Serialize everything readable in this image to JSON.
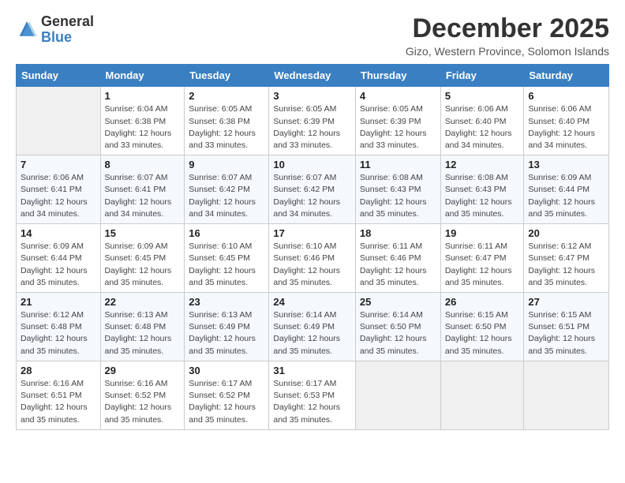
{
  "logo": {
    "general": "General",
    "blue": "Blue"
  },
  "title": "December 2025",
  "location": "Gizo, Western Province, Solomon Islands",
  "days_header": [
    "Sunday",
    "Monday",
    "Tuesday",
    "Wednesday",
    "Thursday",
    "Friday",
    "Saturday"
  ],
  "weeks": [
    [
      {
        "num": "",
        "empty": true
      },
      {
        "num": "1",
        "sunrise": "Sunrise: 6:04 AM",
        "sunset": "Sunset: 6:38 PM",
        "daylight": "Daylight: 12 hours and 33 minutes."
      },
      {
        "num": "2",
        "sunrise": "Sunrise: 6:05 AM",
        "sunset": "Sunset: 6:38 PM",
        "daylight": "Daylight: 12 hours and 33 minutes."
      },
      {
        "num": "3",
        "sunrise": "Sunrise: 6:05 AM",
        "sunset": "Sunset: 6:39 PM",
        "daylight": "Daylight: 12 hours and 33 minutes."
      },
      {
        "num": "4",
        "sunrise": "Sunrise: 6:05 AM",
        "sunset": "Sunset: 6:39 PM",
        "daylight": "Daylight: 12 hours and 33 minutes."
      },
      {
        "num": "5",
        "sunrise": "Sunrise: 6:06 AM",
        "sunset": "Sunset: 6:40 PM",
        "daylight": "Daylight: 12 hours and 34 minutes."
      },
      {
        "num": "6",
        "sunrise": "Sunrise: 6:06 AM",
        "sunset": "Sunset: 6:40 PM",
        "daylight": "Daylight: 12 hours and 34 minutes."
      }
    ],
    [
      {
        "num": "7",
        "sunrise": "Sunrise: 6:06 AM",
        "sunset": "Sunset: 6:41 PM",
        "daylight": "Daylight: 12 hours and 34 minutes."
      },
      {
        "num": "8",
        "sunrise": "Sunrise: 6:07 AM",
        "sunset": "Sunset: 6:41 PM",
        "daylight": "Daylight: 12 hours and 34 minutes."
      },
      {
        "num": "9",
        "sunrise": "Sunrise: 6:07 AM",
        "sunset": "Sunset: 6:42 PM",
        "daylight": "Daylight: 12 hours and 34 minutes."
      },
      {
        "num": "10",
        "sunrise": "Sunrise: 6:07 AM",
        "sunset": "Sunset: 6:42 PM",
        "daylight": "Daylight: 12 hours and 34 minutes."
      },
      {
        "num": "11",
        "sunrise": "Sunrise: 6:08 AM",
        "sunset": "Sunset: 6:43 PM",
        "daylight": "Daylight: 12 hours and 35 minutes."
      },
      {
        "num": "12",
        "sunrise": "Sunrise: 6:08 AM",
        "sunset": "Sunset: 6:43 PM",
        "daylight": "Daylight: 12 hours and 35 minutes."
      },
      {
        "num": "13",
        "sunrise": "Sunrise: 6:09 AM",
        "sunset": "Sunset: 6:44 PM",
        "daylight": "Daylight: 12 hours and 35 minutes."
      }
    ],
    [
      {
        "num": "14",
        "sunrise": "Sunrise: 6:09 AM",
        "sunset": "Sunset: 6:44 PM",
        "daylight": "Daylight: 12 hours and 35 minutes."
      },
      {
        "num": "15",
        "sunrise": "Sunrise: 6:09 AM",
        "sunset": "Sunset: 6:45 PM",
        "daylight": "Daylight: 12 hours and 35 minutes."
      },
      {
        "num": "16",
        "sunrise": "Sunrise: 6:10 AM",
        "sunset": "Sunset: 6:45 PM",
        "daylight": "Daylight: 12 hours and 35 minutes."
      },
      {
        "num": "17",
        "sunrise": "Sunrise: 6:10 AM",
        "sunset": "Sunset: 6:46 PM",
        "daylight": "Daylight: 12 hours and 35 minutes."
      },
      {
        "num": "18",
        "sunrise": "Sunrise: 6:11 AM",
        "sunset": "Sunset: 6:46 PM",
        "daylight": "Daylight: 12 hours and 35 minutes."
      },
      {
        "num": "19",
        "sunrise": "Sunrise: 6:11 AM",
        "sunset": "Sunset: 6:47 PM",
        "daylight": "Daylight: 12 hours and 35 minutes."
      },
      {
        "num": "20",
        "sunrise": "Sunrise: 6:12 AM",
        "sunset": "Sunset: 6:47 PM",
        "daylight": "Daylight: 12 hours and 35 minutes."
      }
    ],
    [
      {
        "num": "21",
        "sunrise": "Sunrise: 6:12 AM",
        "sunset": "Sunset: 6:48 PM",
        "daylight": "Daylight: 12 hours and 35 minutes."
      },
      {
        "num": "22",
        "sunrise": "Sunrise: 6:13 AM",
        "sunset": "Sunset: 6:48 PM",
        "daylight": "Daylight: 12 hours and 35 minutes."
      },
      {
        "num": "23",
        "sunrise": "Sunrise: 6:13 AM",
        "sunset": "Sunset: 6:49 PM",
        "daylight": "Daylight: 12 hours and 35 minutes."
      },
      {
        "num": "24",
        "sunrise": "Sunrise: 6:14 AM",
        "sunset": "Sunset: 6:49 PM",
        "daylight": "Daylight: 12 hours and 35 minutes."
      },
      {
        "num": "25",
        "sunrise": "Sunrise: 6:14 AM",
        "sunset": "Sunset: 6:50 PM",
        "daylight": "Daylight: 12 hours and 35 minutes."
      },
      {
        "num": "26",
        "sunrise": "Sunrise: 6:15 AM",
        "sunset": "Sunset: 6:50 PM",
        "daylight": "Daylight: 12 hours and 35 minutes."
      },
      {
        "num": "27",
        "sunrise": "Sunrise: 6:15 AM",
        "sunset": "Sunset: 6:51 PM",
        "daylight": "Daylight: 12 hours and 35 minutes."
      }
    ],
    [
      {
        "num": "28",
        "sunrise": "Sunrise: 6:16 AM",
        "sunset": "Sunset: 6:51 PM",
        "daylight": "Daylight: 12 hours and 35 minutes."
      },
      {
        "num": "29",
        "sunrise": "Sunrise: 6:16 AM",
        "sunset": "Sunset: 6:52 PM",
        "daylight": "Daylight: 12 hours and 35 minutes."
      },
      {
        "num": "30",
        "sunrise": "Sunrise: 6:17 AM",
        "sunset": "Sunset: 6:52 PM",
        "daylight": "Daylight: 12 hours and 35 minutes."
      },
      {
        "num": "31",
        "sunrise": "Sunrise: 6:17 AM",
        "sunset": "Sunset: 6:53 PM",
        "daylight": "Daylight: 12 hours and 35 minutes."
      },
      {
        "num": "",
        "empty": true
      },
      {
        "num": "",
        "empty": true
      },
      {
        "num": "",
        "empty": true
      }
    ]
  ]
}
